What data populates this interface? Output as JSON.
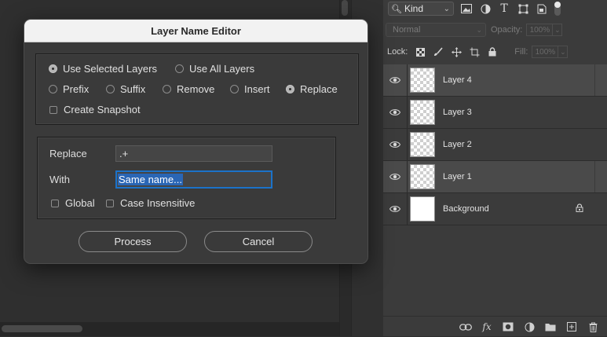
{
  "dialog": {
    "title": "Layer Name Editor",
    "scope_options": [
      {
        "label": "Use Selected Layers",
        "selected": true
      },
      {
        "label": "Use All Layers",
        "selected": false
      }
    ],
    "mode_options": [
      {
        "label": "Prefix",
        "selected": false
      },
      {
        "label": "Suffix",
        "selected": false
      },
      {
        "label": "Remove",
        "selected": false
      },
      {
        "label": "Insert",
        "selected": false
      },
      {
        "label": "Replace",
        "selected": true
      }
    ],
    "create_snapshot": {
      "label": "Create Snapshot",
      "checked": false
    },
    "replace": {
      "label": "Replace",
      "value": ".+"
    },
    "with": {
      "label": "With",
      "value": "Same name..."
    },
    "global": {
      "label": "Global",
      "checked": false
    },
    "case_insensitive": {
      "label": "Case Insensitive",
      "checked": false
    },
    "process_label": "Process",
    "cancel_label": "Cancel"
  },
  "layers_panel": {
    "filter_kind": "Kind",
    "blend_mode": "Normal",
    "opacity_label": "Opacity:",
    "opacity_value": "100%",
    "lock_label": "Lock:",
    "fill_label": "Fill:",
    "fill_value": "100%",
    "layers": [
      {
        "name": "Layer 4",
        "selected": true,
        "thumb": "transparent"
      },
      {
        "name": "Layer 3",
        "selected": false,
        "thumb": "transparent"
      },
      {
        "name": "Layer 2",
        "selected": false,
        "thumb": "transparent"
      },
      {
        "name": "Layer 1",
        "selected": true,
        "thumb": "transparent"
      },
      {
        "name": "Background",
        "selected": false,
        "thumb": "white",
        "locked": true
      }
    ]
  },
  "colors": {
    "focus_ring": "#1b72c9",
    "selection_highlight": "#2a66b5",
    "dialog_bg": "#3a3a3a",
    "title_bar_bg": "#f2f2f2"
  }
}
